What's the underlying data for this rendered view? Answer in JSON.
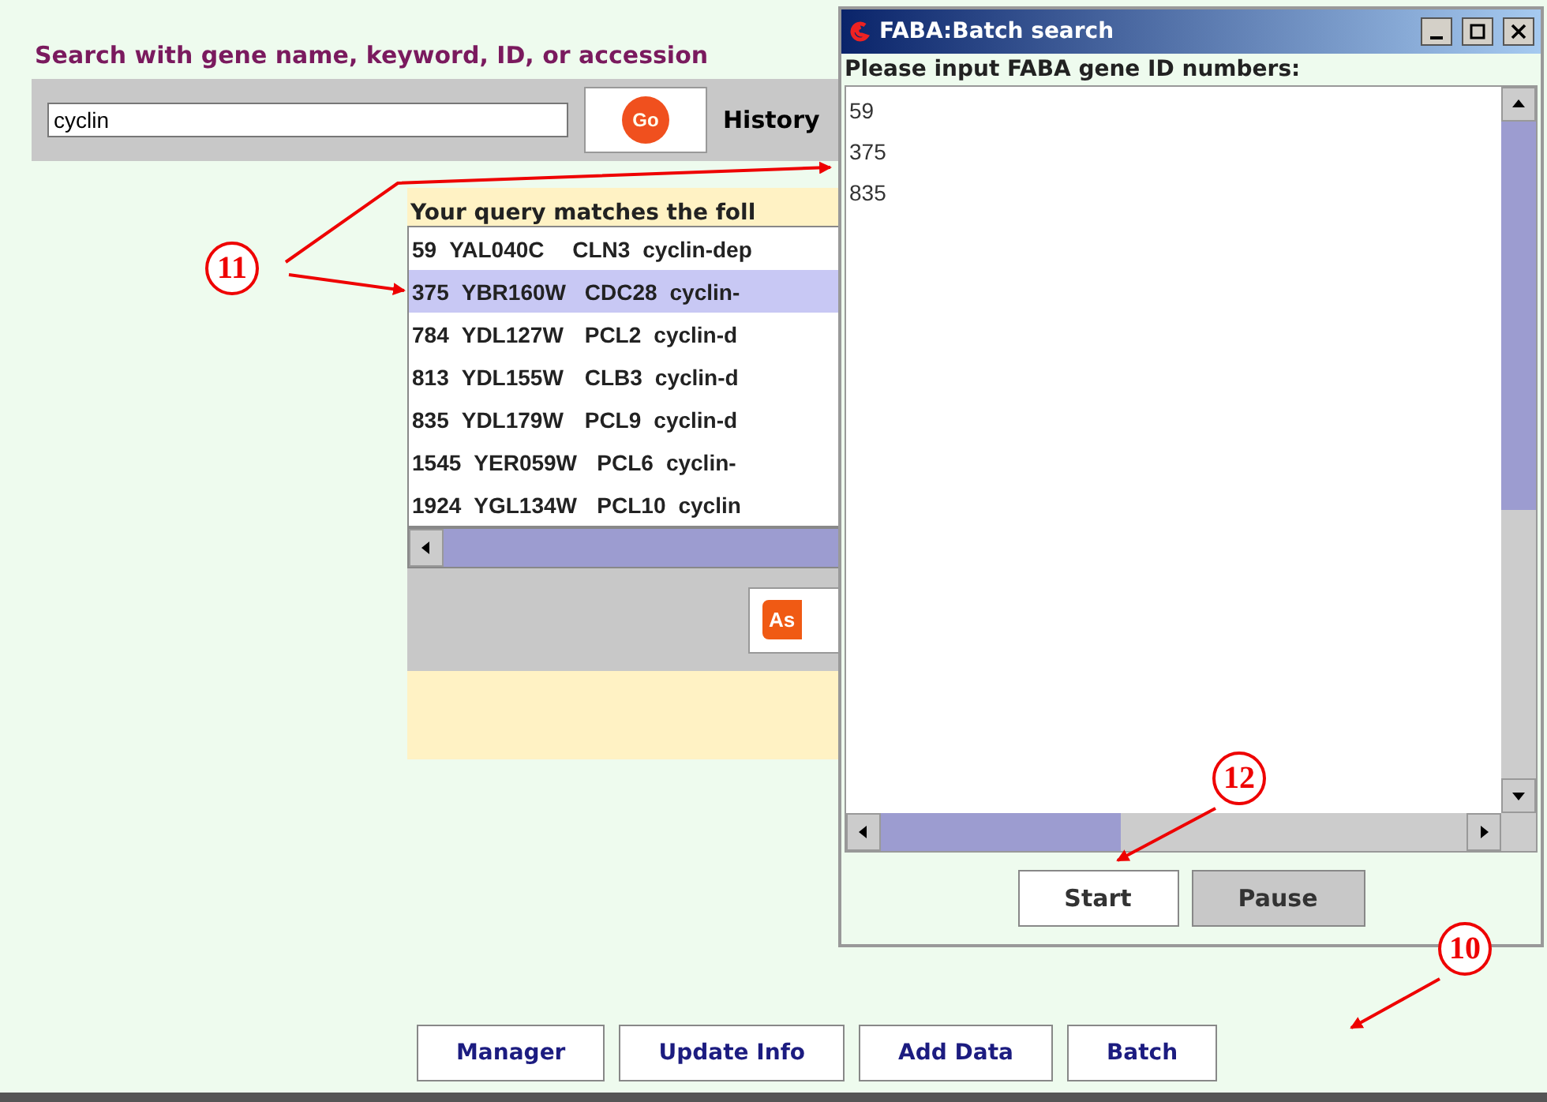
{
  "page": {
    "heading": "Search with gene name, keyword, ID, or accession",
    "search": {
      "value": "cyclin"
    },
    "go_button": "Go",
    "history_label": "History"
  },
  "results": {
    "heading": "Your query matches the foll",
    "rows": [
      {
        "id": "59",
        "orf": "YAL040C",
        "gene": "CLN3",
        "description": "cyclin-dep",
        "selected": false
      },
      {
        "id": "375",
        "orf": "YBR160W",
        "gene": "CDC28",
        "description": "cyclin-",
        "selected": true
      },
      {
        "id": "784",
        "orf": "YDL127W",
        "gene": "PCL2",
        "description": "cyclin-d",
        "selected": false
      },
      {
        "id": "813",
        "orf": "YDL155W",
        "gene": "CLB3",
        "description": "cyclin-d",
        "selected": false
      },
      {
        "id": "835",
        "orf": "YDL179W",
        "gene": "PCL9",
        "description": "cyclin-d",
        "selected": false
      },
      {
        "id": "1545",
        "orf": "YER059W",
        "gene": "PCL6",
        "description": "cyclin-",
        "selected": false
      },
      {
        "id": "1924",
        "orf": "YGL134W",
        "gene": "PCL10",
        "description": "cyclin",
        "selected": false
      }
    ],
    "action_button": "As"
  },
  "toolbar": [
    "Manager",
    "Update Info",
    "Add Data",
    "Batch"
  ],
  "dialog": {
    "title": "FABA:Batch search",
    "prompt": "Please input FABA gene ID numbers:",
    "ids": [
      "59",
      "375",
      "835"
    ],
    "buttons": [
      {
        "label": "Start",
        "kind": "primary"
      },
      {
        "label": "Pause",
        "kind": "secondary"
      }
    ]
  },
  "annotations": [
    {
      "number": "11"
    },
    {
      "number": "12"
    },
    {
      "number": "10"
    }
  ]
}
